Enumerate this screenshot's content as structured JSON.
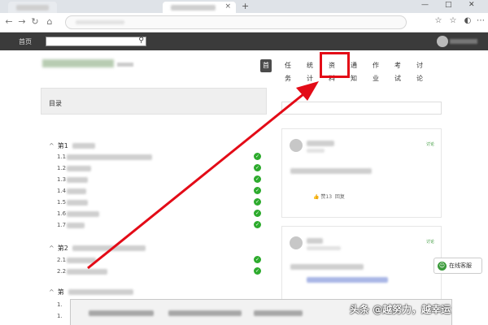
{
  "browser": {
    "tab_close": "×",
    "new_tab": "+",
    "win_min": "—",
    "win_max": "□",
    "win_close": "✕"
  },
  "header": {
    "home": "首页"
  },
  "nav_tabs": [
    {
      "label": "首页",
      "active": true
    },
    {
      "label": "任务",
      "active": false
    },
    {
      "label": "统计",
      "active": false
    },
    {
      "label": "资料",
      "active": false
    },
    {
      "label": "通知",
      "active": false
    },
    {
      "label": "作业",
      "active": false
    },
    {
      "label": "考试",
      "active": false
    },
    {
      "label": "讨论",
      "active": false
    }
  ],
  "toc": {
    "title": "目录",
    "chapters": [
      {
        "label": "第1",
        "items": [
          "1.1",
          "1.2",
          "1.3",
          "1.4",
          "1.5",
          "1.6",
          "1.7"
        ]
      },
      {
        "label": "第2",
        "items": [
          "2.1",
          "2.2"
        ]
      },
      {
        "label": "第",
        "items": [
          "1.",
          "1."
        ]
      }
    ]
  },
  "feed": {
    "tag": "讨论",
    "likes": "赞13",
    "reply": "回复"
  },
  "chat_button": "在线客服",
  "watermark": "头条 @越努力，越幸运",
  "colors": {
    "accent_red": "#e30b17",
    "check_green": "#2dab2d",
    "nav_active": "#4b4b4b",
    "site_header": "#3b3b3b"
  }
}
